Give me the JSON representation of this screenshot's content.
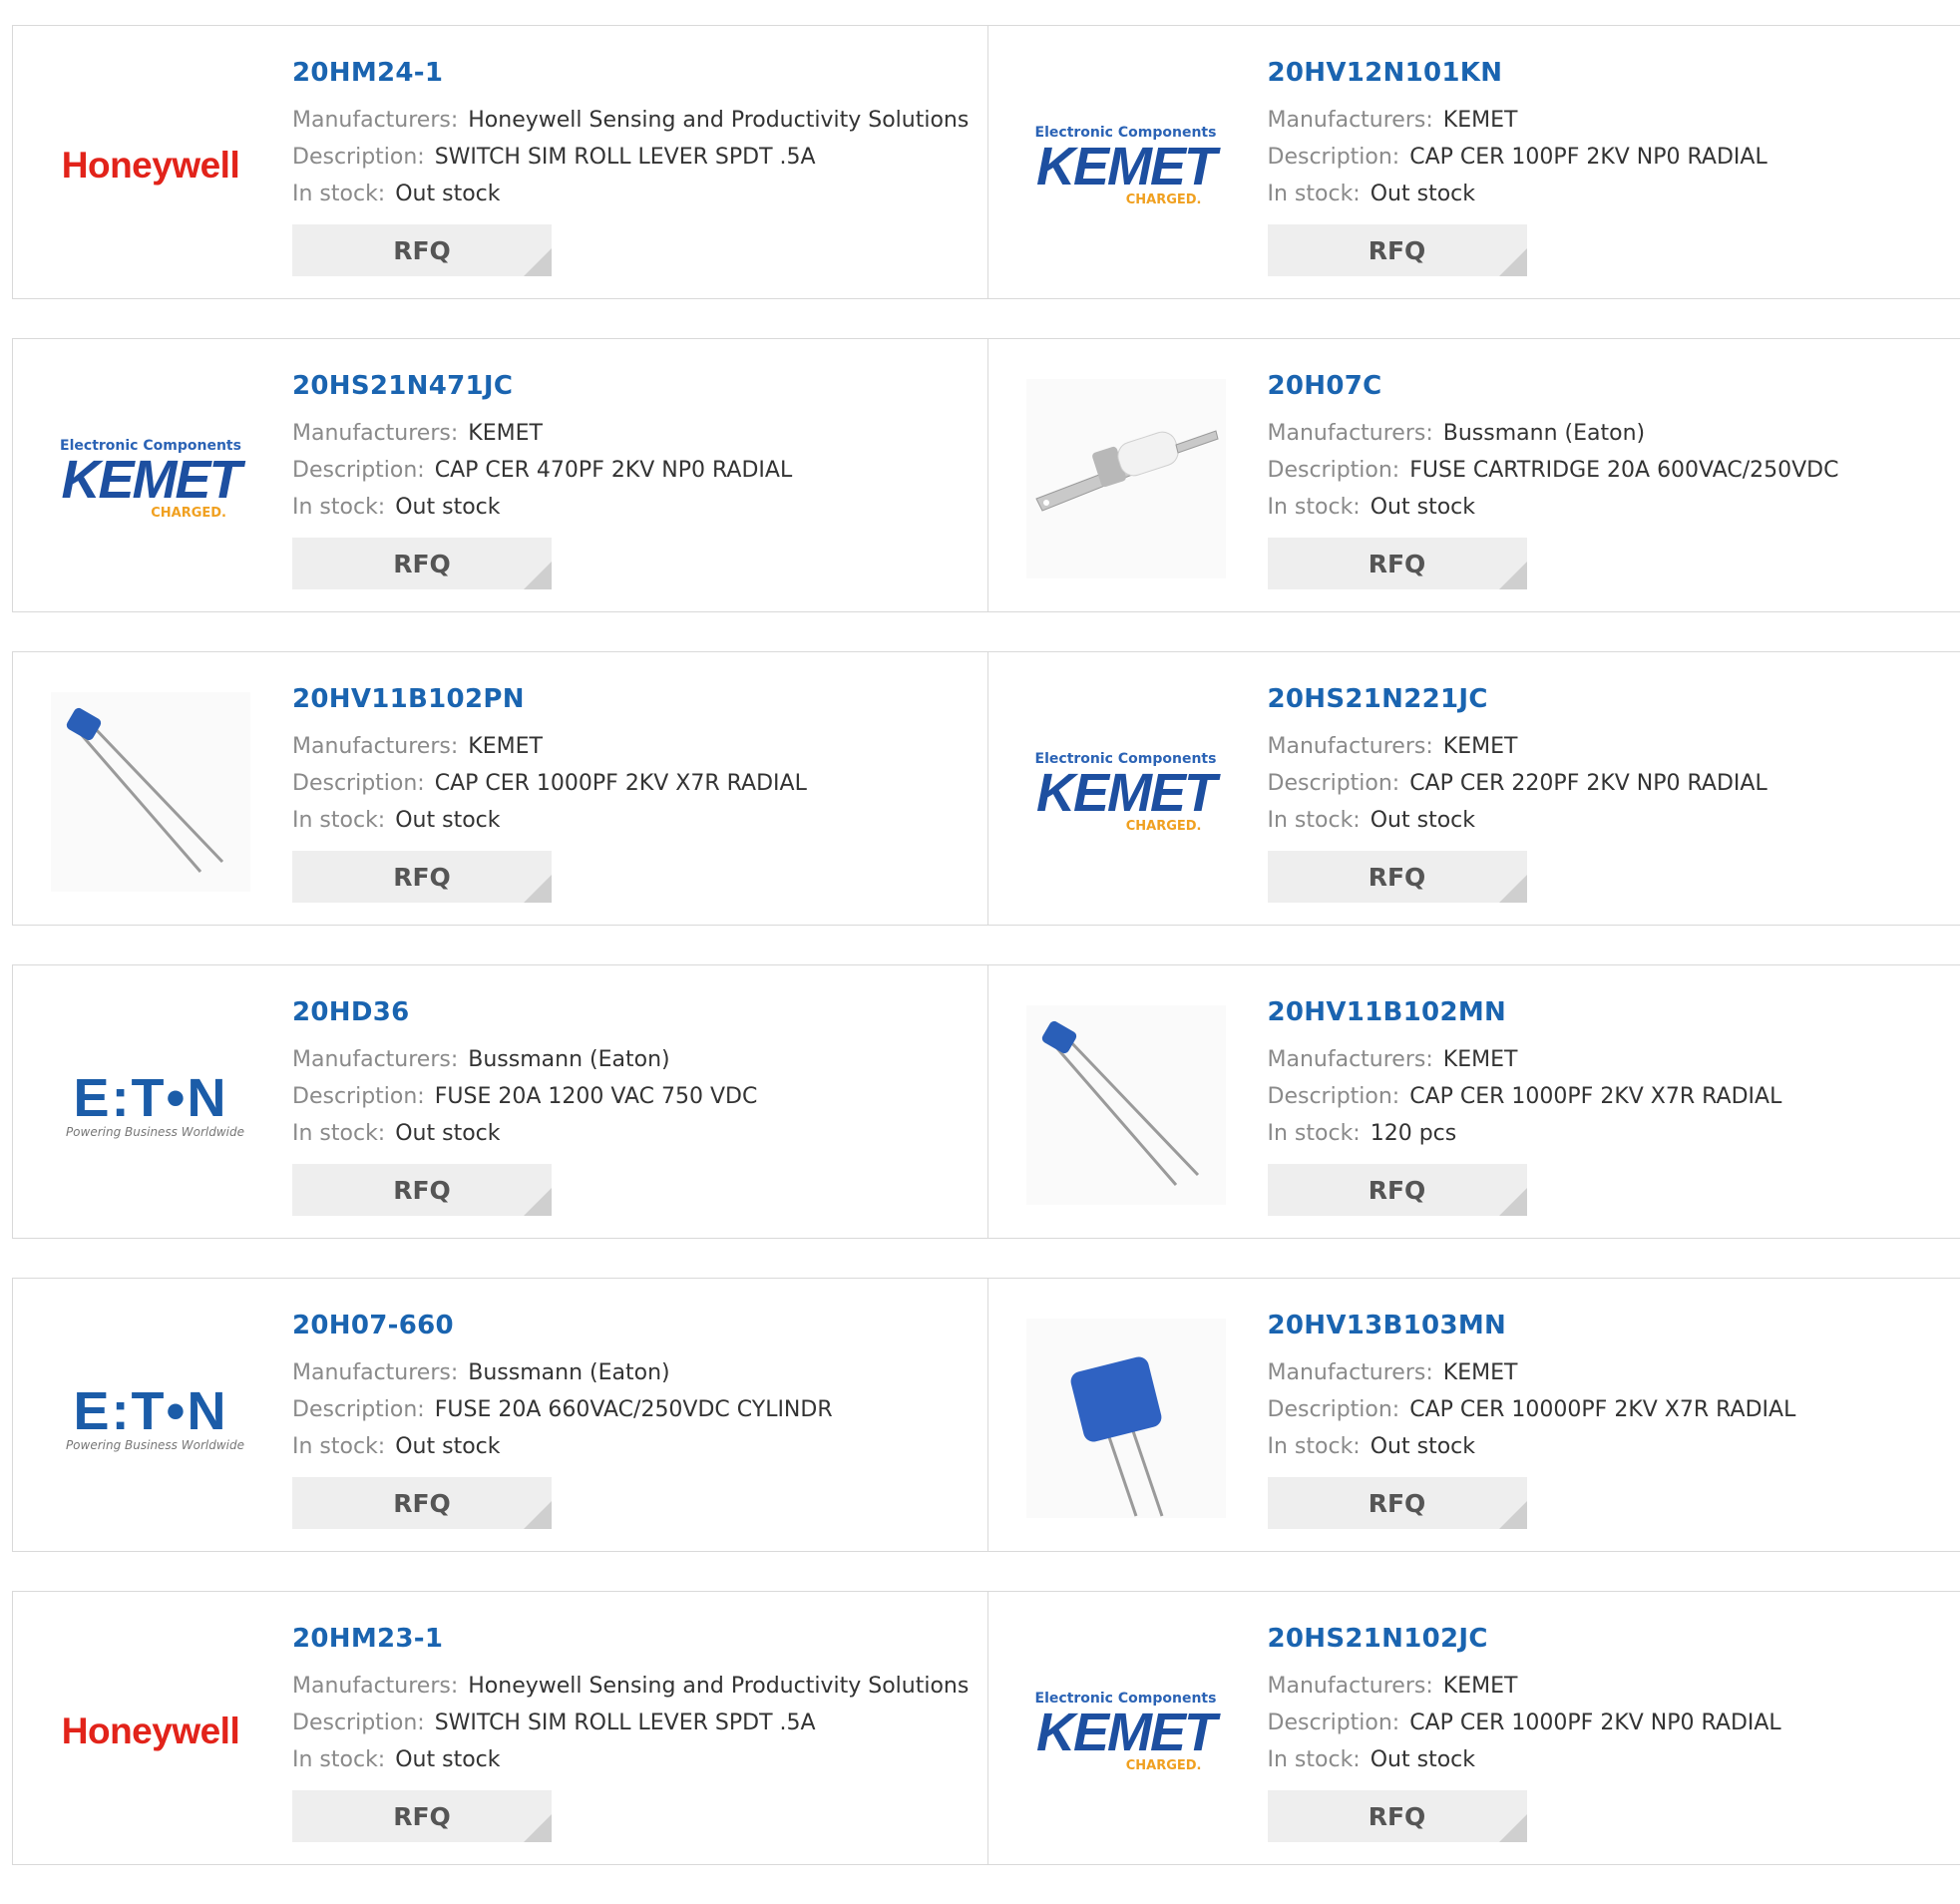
{
  "labels": {
    "manufacturers": "Manufacturers:",
    "description": "Description:",
    "in_stock": "In stock:",
    "rfq": "RFQ"
  },
  "logos": {
    "honeywell": "Honeywell",
    "kemet_top": "Electronic Components",
    "kemet_main": "KEMET",
    "kemet_sub": "CHARGED.",
    "eaton_main": "E:T•N",
    "eaton_sub": "Powering Business Worldwide"
  },
  "colors": {
    "part_link": "#1a64b0",
    "label_gray": "#8a8a8a",
    "rfq_bg": "#eeeeee",
    "honeywell_red": "#e2231a",
    "kemet_blue": "#1d4fa0",
    "kemet_orange": "#f0a020",
    "eaton_blue": "#1b5ca8"
  },
  "rows": [
    {
      "left": {
        "part": "20HM24-1",
        "manufacturer": "Honeywell Sensing and Productivity Solutions",
        "description": "SWITCH SIM ROLL LEVER SPDT .5A",
        "stock": "Out stock",
        "thumb": "honeywell-logo"
      },
      "right": {
        "part": "20HV12N101KN",
        "manufacturer": "KEMET",
        "description": "CAP CER 100PF 2KV NP0 RADIAL",
        "stock": "Out stock",
        "thumb": "kemet-logo"
      }
    },
    {
      "left": {
        "part": "20HS21N471JC",
        "manufacturer": "KEMET",
        "description": "CAP CER 470PF 2KV NP0 RADIAL",
        "stock": "Out stock",
        "thumb": "kemet-logo"
      },
      "right": {
        "part": "20H07C",
        "manufacturer": "Bussmann (Eaton)",
        "description": "FUSE CARTRIDGE 20A 600VAC/250VDC",
        "stock": "Out stock",
        "thumb": "fuse-photo"
      }
    },
    {
      "left": {
        "part": "20HV11B102PN",
        "manufacturer": "KEMET",
        "description": "CAP CER 1000PF 2KV X7R RADIAL",
        "stock": "Out stock",
        "thumb": "capacitor-small-photo"
      },
      "right": {
        "part": "20HS21N221JC",
        "manufacturer": "KEMET",
        "description": "CAP CER 220PF 2KV NP0 RADIAL",
        "stock": "Out stock",
        "thumb": "kemet-logo"
      }
    },
    {
      "left": {
        "part": "20HD36",
        "manufacturer": "Bussmann (Eaton)",
        "description": "FUSE 20A 1200 VAC 750 VDC",
        "stock": "Out stock",
        "thumb": "eaton-logo"
      },
      "right": {
        "part": "20HV11B102MN",
        "manufacturer": "KEMET",
        "description": "CAP CER 1000PF 2KV X7R RADIAL",
        "stock": "120 pcs",
        "thumb": "capacitor-small-photo"
      }
    },
    {
      "left": {
        "part": "20H07-660",
        "manufacturer": "Bussmann (Eaton)",
        "description": "FUSE 20A 660VAC/250VDC CYLINDR",
        "stock": "Out stock",
        "thumb": "eaton-logo"
      },
      "right": {
        "part": "20HV13B103MN",
        "manufacturer": "KEMET",
        "description": "CAP CER 10000PF 2KV X7R RADIAL",
        "stock": "Out stock",
        "thumb": "capacitor-large-photo"
      }
    },
    {
      "left": {
        "part": "20HM23-1",
        "manufacturer": "Honeywell Sensing and Productivity Solutions",
        "description": "SWITCH SIM ROLL LEVER SPDT .5A",
        "stock": "Out stock",
        "thumb": "honeywell-logo"
      },
      "right": {
        "part": "20HS21N102JC",
        "manufacturer": "KEMET",
        "description": "CAP CER 1000PF 2KV NP0 RADIAL",
        "stock": "Out stock",
        "thumb": "kemet-logo"
      }
    }
  ]
}
